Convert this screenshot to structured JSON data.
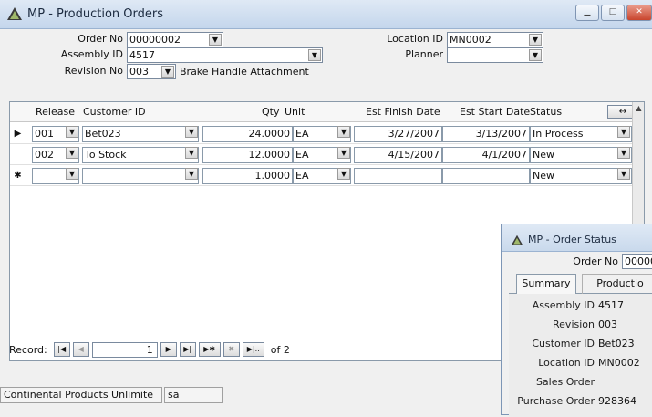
{
  "window": {
    "title": "MP - Production Orders"
  },
  "header": {
    "order_no_label": "Order No",
    "order_no": "00000002",
    "assembly_id_label": "Assembly ID",
    "assembly_id": "4517",
    "revision_no_label": "Revision No",
    "revision_no": "003",
    "revision_desc": "Brake Handle Attachment",
    "location_id_label": "Location ID",
    "location_id": "MN0002",
    "planner_label": "Planner",
    "planner": ""
  },
  "grid": {
    "columns": [
      "Release",
      "Customer ID",
      "Qty",
      "Unit",
      "Est Finish Date",
      "Est Start Date",
      "Status"
    ],
    "resize_button": "↔",
    "rows": [
      {
        "selector": "▶",
        "release": "001",
        "customer": "Bet023",
        "qty": "24.0000",
        "unit": "EA",
        "finish": "3/27/2007",
        "start": "3/13/2007",
        "status": "In Process"
      },
      {
        "selector": "",
        "release": "002",
        "customer": "To Stock",
        "qty": "12.0000",
        "unit": "EA",
        "finish": "4/15/2007",
        "start": "4/1/2007",
        "status": "New"
      },
      {
        "selector": "✱",
        "release": "",
        "customer": "",
        "qty": "1.0000",
        "unit": "EA",
        "finish": "",
        "start": "",
        "status": "New"
      }
    ]
  },
  "nav": {
    "record_label": "Record:",
    "current": "1",
    "of_label": "of 2"
  },
  "statusbar": {
    "company": "Continental Products Unlimite",
    "user": "sa"
  },
  "order_status": {
    "title": "MP - Order Status",
    "order_no_label": "Order No",
    "order_no": "00000",
    "tabs": [
      "Summary",
      "Productio"
    ],
    "fields": [
      {
        "label": "Assembly ID",
        "value": "4517"
      },
      {
        "label": "Revision",
        "value": "003"
      },
      {
        "label": "Customer ID",
        "value": "Bet023"
      },
      {
        "label": "Location ID",
        "value": "MN0002"
      },
      {
        "label": "Sales Order",
        "value": ""
      },
      {
        "label": "Purchase Order",
        "value": "928364"
      }
    ]
  },
  "colors": {
    "titlebar": "#c4d6ec",
    "close": "#c9452d"
  }
}
